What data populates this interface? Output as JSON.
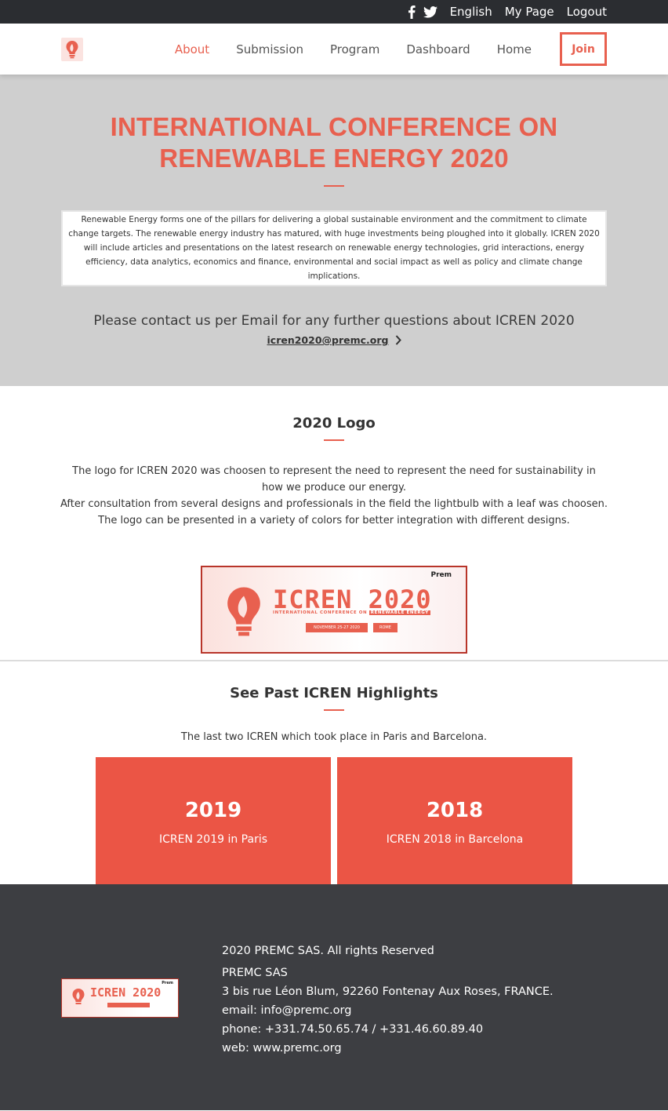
{
  "topbar": {
    "language": "English",
    "my_page": "My Page",
    "logout": "Logout"
  },
  "nav": {
    "items": [
      {
        "label": "About",
        "active": true
      },
      {
        "label": "Submission",
        "active": false
      },
      {
        "label": "Program",
        "active": false
      },
      {
        "label": "Dashboard",
        "active": false
      },
      {
        "label": "Home",
        "active": false
      }
    ],
    "join_label": "Join"
  },
  "hero": {
    "title_line1": "INTERNATIONAL CONFERENCE ON",
    "title_line2": "RENEWABLE ENERGY 2020",
    "description": "Renewable Energy forms one of the pillars for delivering a global sustainable environment and the commitment to climate change targets. The renewable energy industry has matured, with huge investments being ploughed into it globally. ICREN 2020 will include articles and presentations on the latest research on renewable energy technologies, grid interactions, energy efficiency, data analytics, economics and finance, environmental and social impact as well as policy and climate change implications.",
    "contact_text": "Please contact us per Email for any further questions about ICREN 2020",
    "contact_email": "icren2020@premc.org"
  },
  "logo_section": {
    "heading": "2020 Logo",
    "para1": "The logo for ICREN 2020 was choosen to represent the need to represent the need for sustainability in how we produce our energy.",
    "para2": "After consultation from several designs and professionals in the field the lightbulb with a leaf was choosen.",
    "para3": "The logo can be presented in a variety of colors for better integration with different designs.",
    "banner": {
      "title": "ICREN 2020",
      "subtitle_a": "INTERNATIONAL CONFERENCE ON",
      "subtitle_b": "RENEWABLE ENERGY",
      "date": "NOVEMBER 25-27 2020",
      "city": "ROME",
      "brand": "Prem"
    }
  },
  "past": {
    "heading": "See Past ICREN Highlights",
    "subtitle": "The last two ICREN which took place in Paris and Barcelona.",
    "cards": [
      {
        "year": "2019",
        "text": "ICREN 2019 in Paris"
      },
      {
        "year": "2018",
        "text": "ICREN 2018 in Barcelona"
      }
    ]
  },
  "footer": {
    "banner_title": "ICREN 2020",
    "banner_brand": "Prem",
    "copyright": "2020 PREMC SAS. All rights Reserved",
    "company": "PREMC SAS",
    "address": "3 bis rue Léon Blum, 92260 Fontenay Aux Roses, FRANCE.",
    "email": "email: info@premc.org",
    "phone": "phone: +331.74.50.65.74 / +331.46.60.89.40",
    "web": "web: www.premc.org"
  },
  "colors": {
    "accent": "#e8604f",
    "card": "#eb5545",
    "topbar": "#2b2d31",
    "footer": "#3d3e42",
    "hero_bg": "#cfcfcf"
  },
  "icons": [
    "facebook-icon",
    "twitter-icon",
    "logo-bulb-icon",
    "chevron-right-icon"
  ]
}
